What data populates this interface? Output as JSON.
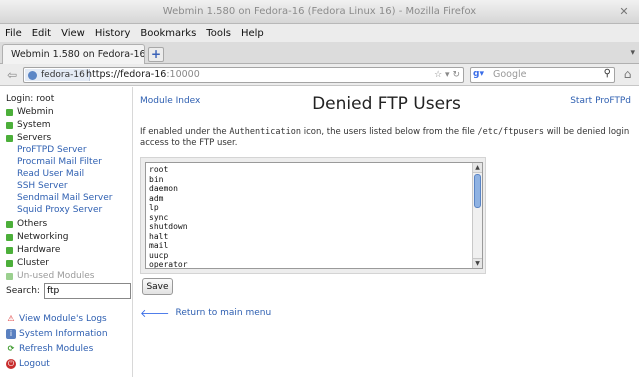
{
  "window": {
    "title": "Webmin 1.580 on Fedora-16 (Fedora Linux 16) - Mozilla Firefox"
  },
  "menu": [
    "File",
    "Edit",
    "View",
    "History",
    "Bookmarks",
    "Tools",
    "Help"
  ],
  "tab": {
    "title": "Webmin 1.580 on Fedora-16 (F..."
  },
  "navbar": {
    "identity": "fedora-16",
    "url_scheme_host": "https://fedora-16",
    "url_port": ":10000",
    "search_placeholder": "Google"
  },
  "sidebar": {
    "login": "Login: root",
    "categories": [
      {
        "label": "Webmin",
        "color": "#4caf3a"
      },
      {
        "label": "System",
        "color": "#4caf3a"
      },
      {
        "label": "Servers",
        "color": "#4caf3a"
      }
    ],
    "server_links": [
      "ProFTPD Server",
      "Procmail Mail Filter",
      "Read User Mail",
      "SSH Server",
      "Sendmail Mail Server",
      "Squid Proxy Server"
    ],
    "more_categories": [
      {
        "label": "Others",
        "color": "#4caf3a"
      },
      {
        "label": "Networking",
        "color": "#4caf3a"
      },
      {
        "label": "Hardware",
        "color": "#4caf3a"
      },
      {
        "label": "Cluster",
        "color": "#4caf3a"
      },
      {
        "label": "Un-used Modules",
        "color": "#9bd08f"
      }
    ],
    "search_label": "Search:",
    "search_value": "ftp",
    "actions": [
      {
        "label": "View Module's Logs",
        "icon": "warning-icon"
      },
      {
        "label": "System Information",
        "icon": "info-icon"
      },
      {
        "label": "Refresh Modules",
        "icon": "refresh-icon"
      },
      {
        "label": "Logout",
        "icon": "logout-icon"
      }
    ]
  },
  "main": {
    "module_index": "Module Index",
    "start_link": "Start ProFTPd",
    "heading": "Denied FTP Users",
    "desc_1": "If enabled under the ",
    "desc_auth": "Authentication",
    "desc_2": " icon, the users listed below from the file ",
    "desc_file": "/etc/ftpusers",
    "desc_3": " will be denied login access to the FTP user.",
    "users_text": "root\nbin\ndaemon\nadm\nlp\nsync\nshutdown\nhalt\nmail\nuucp\noperator",
    "save_label": "Save",
    "return_label": "Return to main menu"
  }
}
